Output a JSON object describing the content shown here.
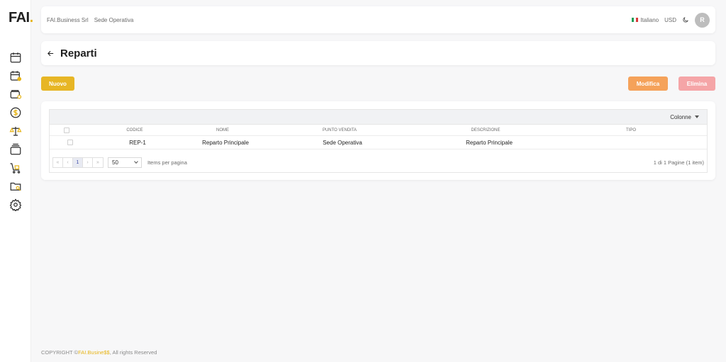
{
  "brand": {
    "logo_text": "FAI",
    "logo_dot": ".",
    "accent": "#e6b417"
  },
  "sidebar": {
    "items": [
      {
        "icon": "calendar-icon"
      },
      {
        "icon": "calendar-user-icon"
      },
      {
        "icon": "wallet-clock-icon"
      },
      {
        "icon": "dollar-coin-icon"
      },
      {
        "icon": "scale-icon"
      },
      {
        "icon": "stack-icon"
      },
      {
        "icon": "cart-icon"
      },
      {
        "icon": "folder-search-icon"
      },
      {
        "icon": "gear-icon"
      }
    ]
  },
  "topbar": {
    "company": "FAI.Business Srl",
    "location": "Sede Operativa",
    "language": "Italiano",
    "currency": "USD",
    "avatar_initial": "R"
  },
  "page": {
    "title": "Reparti"
  },
  "actions": {
    "new": "Nuovo",
    "edit": "Modifica",
    "delete": "Elimina",
    "new_color": "#e7b625",
    "edit_color": "#f5a25a",
    "delete_color": "#f5a5a7"
  },
  "table": {
    "columns_button": "Colonne",
    "headers": [
      "CODICE",
      "NOME",
      "PUNTO VENDITA",
      "DESCRIZIONE",
      "TIPO"
    ],
    "rows": [
      {
        "codice": "REP-1",
        "nome": "Reparto Principale",
        "punto_vendita": "Sede Operativa",
        "descrizione": "Reparto Principale",
        "tipo": ""
      }
    ]
  },
  "pager": {
    "first": "«",
    "prev": "‹",
    "current_page": "1",
    "next": "›",
    "last": "»",
    "per_page": "50",
    "items_label": "Items per pagina",
    "page_info": "1 di 1 Pagine (1 item)"
  },
  "footer": {
    "prefix": "COPYRIGHT ©",
    "brand": "FAI.Busine$$",
    "suffix": ", All rights Reserved"
  }
}
